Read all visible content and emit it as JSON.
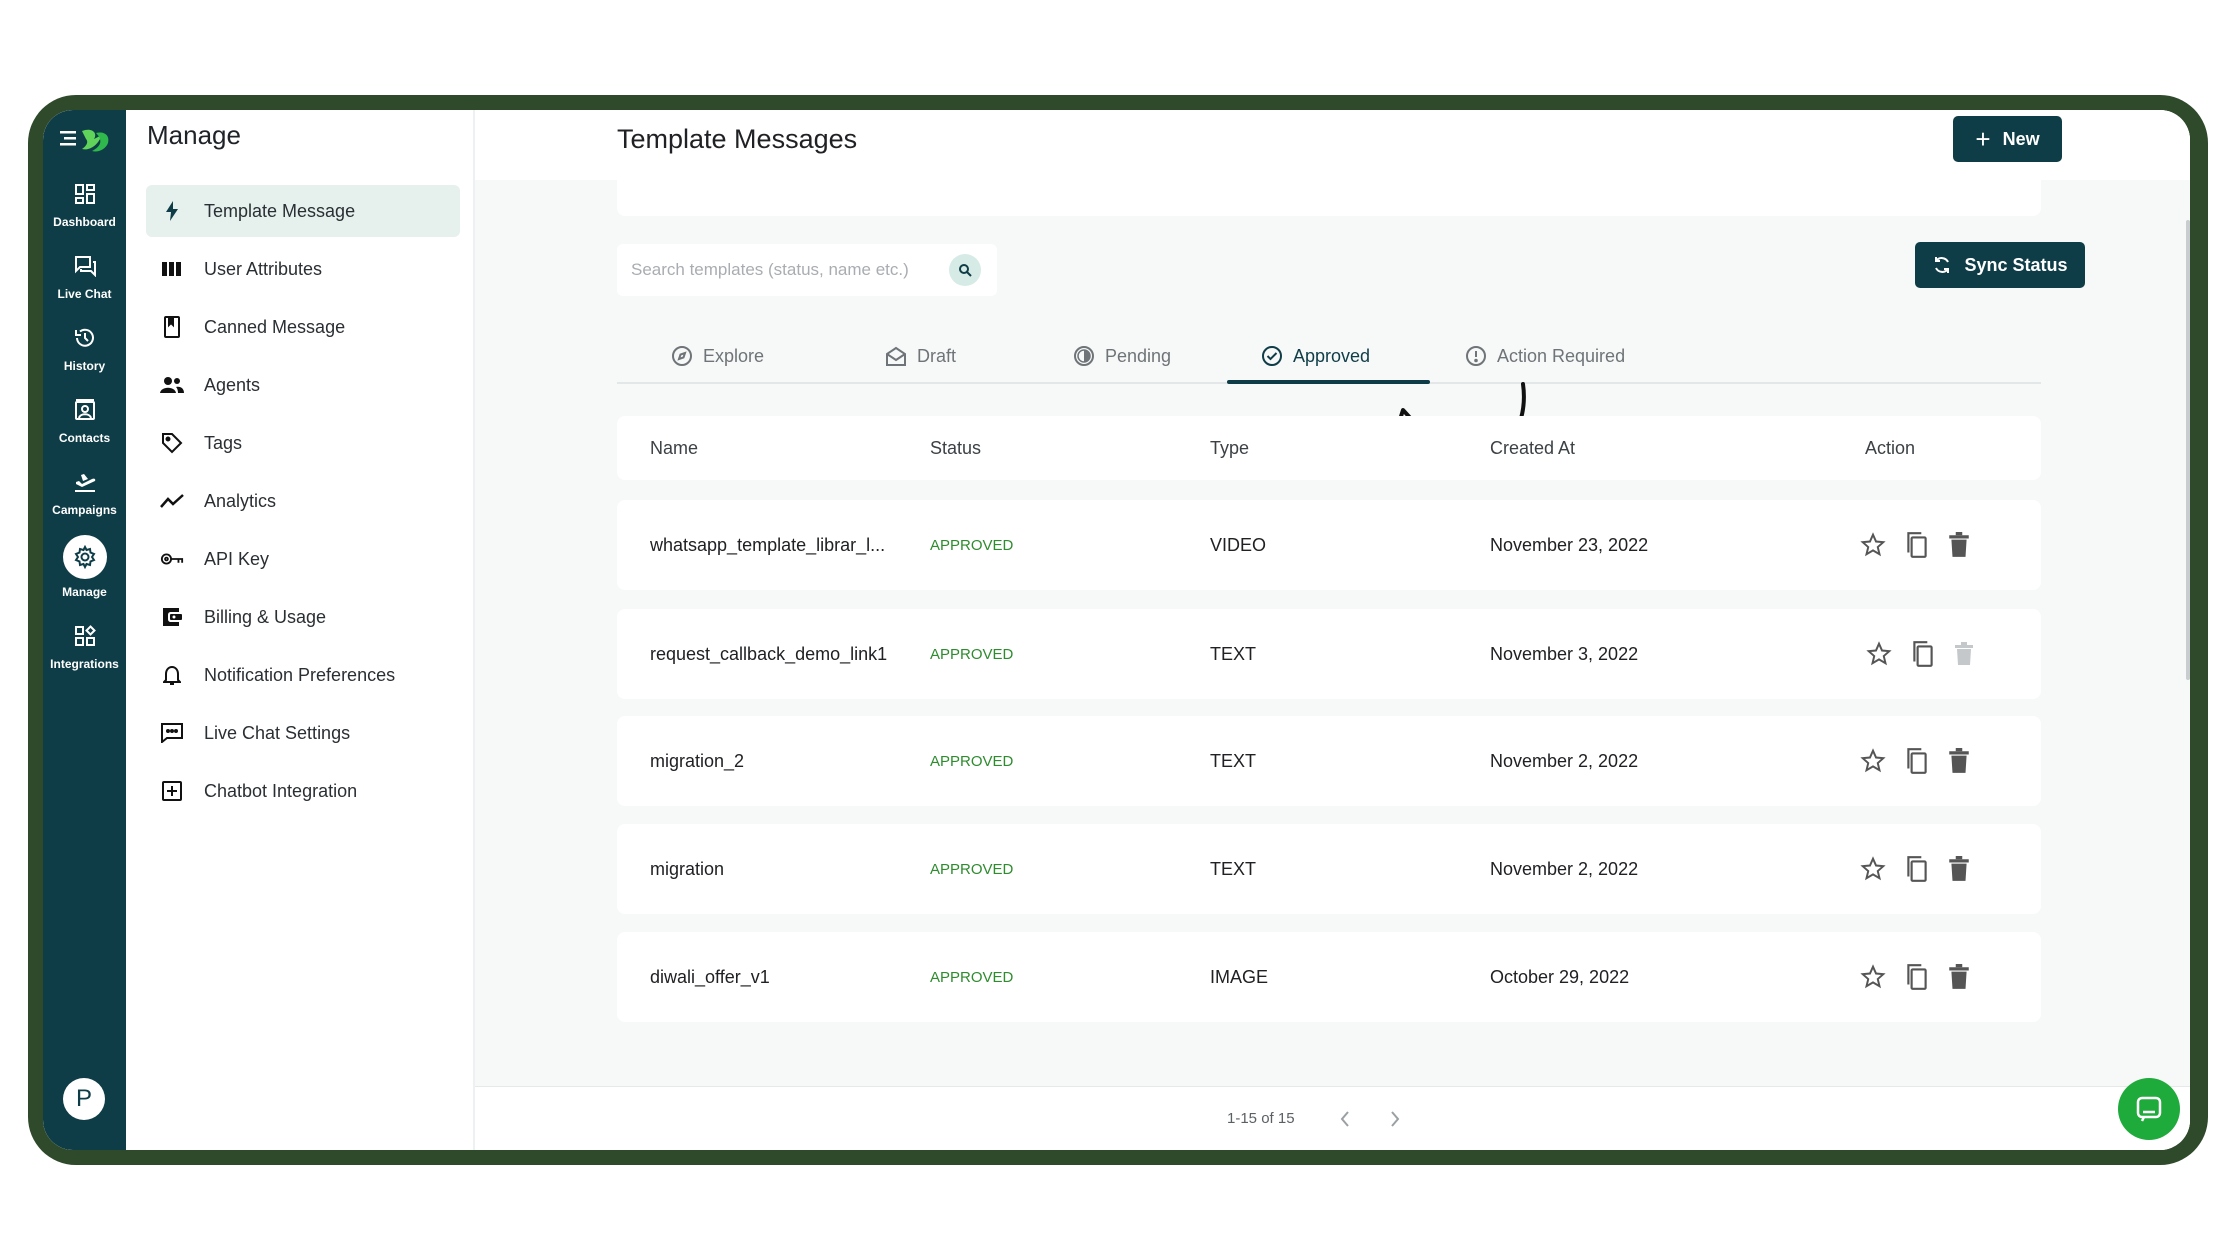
{
  "sidebar": {
    "items": [
      {
        "label": "Dashboard",
        "icon": "dashboard-icon"
      },
      {
        "label": "Live Chat",
        "icon": "chat-icon"
      },
      {
        "label": "History",
        "icon": "history-icon"
      },
      {
        "label": "Contacts",
        "icon": "contacts-icon"
      },
      {
        "label": "Campaigns",
        "icon": "campaigns-icon"
      },
      {
        "label": "Manage",
        "icon": "gear-icon",
        "active": true
      },
      {
        "label": "Integrations",
        "icon": "integrations-icon"
      }
    ],
    "avatar_initial": "P"
  },
  "manage_nav": {
    "title": "Manage",
    "items": [
      {
        "label": "Template Message",
        "icon": "bolt-icon",
        "active": true
      },
      {
        "label": "User Attributes",
        "icon": "columns-icon"
      },
      {
        "label": "Canned Message",
        "icon": "bookmark-icon"
      },
      {
        "label": "Agents",
        "icon": "people-icon"
      },
      {
        "label": "Tags",
        "icon": "tag-icon"
      },
      {
        "label": "Analytics",
        "icon": "trend-icon"
      },
      {
        "label": "API Key",
        "icon": "key-icon"
      },
      {
        "label": "Billing & Usage",
        "icon": "wallet-icon"
      },
      {
        "label": "Notification Preferences",
        "icon": "bell-icon"
      },
      {
        "label": "Live Chat Settings",
        "icon": "message-icon"
      },
      {
        "label": "Chatbot Integration",
        "icon": "add-box-icon"
      }
    ]
  },
  "main": {
    "title": "Template Messages",
    "new_button": "New",
    "search_placeholder": "Search templates (status, name etc.)",
    "sync_button": "Sync Status",
    "tabs": [
      {
        "label": "Explore",
        "icon": "compass-icon"
      },
      {
        "label": "Draft",
        "icon": "mail-open-icon"
      },
      {
        "label": "Pending",
        "icon": "half-circle-icon"
      },
      {
        "label": "Approved",
        "icon": "check-circle-icon",
        "active": true
      },
      {
        "label": "Action Required",
        "icon": "info-icon"
      }
    ],
    "columns": [
      "Name",
      "Status",
      "Type",
      "Created At",
      "Action"
    ],
    "rows": [
      {
        "name": "whatsapp_template_librar_l...",
        "status": "APPROVED",
        "type": "VIDEO",
        "created": "November 23, 2022"
      },
      {
        "name": "request_callback_demo_link1",
        "status": "APPROVED",
        "type": "TEXT",
        "created": "November 3, 2022"
      },
      {
        "name": "migration_2",
        "status": "APPROVED",
        "type": "TEXT",
        "created": "November 2, 2022"
      },
      {
        "name": "migration",
        "status": "APPROVED",
        "type": "TEXT",
        "created": "November 2, 2022"
      },
      {
        "name": "diwali_offer_v1",
        "status": "APPROVED",
        "type": "IMAGE",
        "created": "October 29, 2022"
      }
    ],
    "pagination": "1-15 of 15"
  },
  "colors": {
    "frame": "#2f4a2b",
    "rail": "#0f3d47",
    "primary": "#0f3d47",
    "approved": "#2e8b2e",
    "chat_fab": "#1faa3c"
  }
}
